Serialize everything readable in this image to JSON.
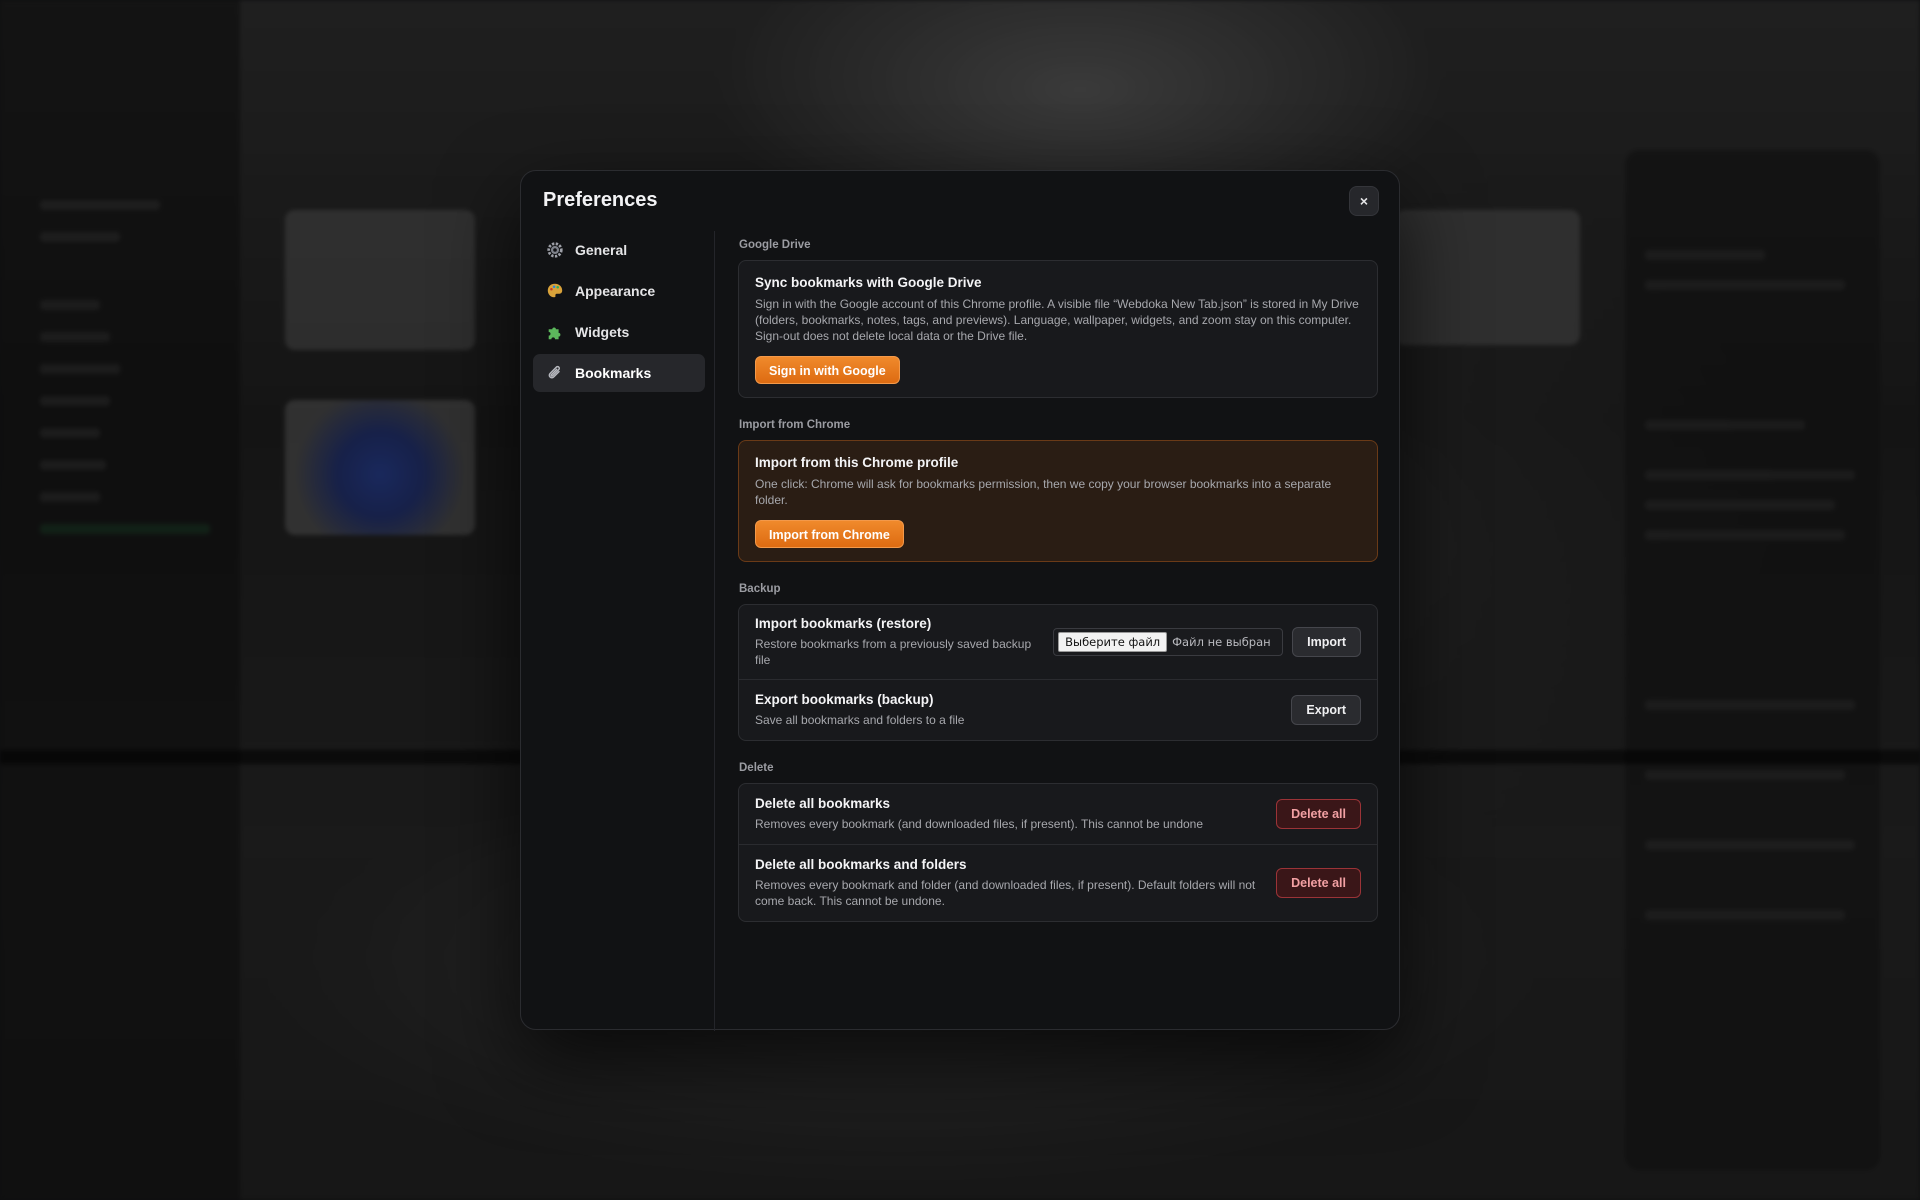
{
  "modal": {
    "title": "Preferences",
    "close_label": "×"
  },
  "nav": {
    "items": [
      {
        "label": "General",
        "icon": "gear-icon",
        "active": false
      },
      {
        "label": "Appearance",
        "icon": "palette-icon",
        "active": false
      },
      {
        "label": "Widgets",
        "icon": "puzzle-icon",
        "active": false
      },
      {
        "label": "Bookmarks",
        "icon": "paperclip-icon",
        "active": true
      }
    ]
  },
  "google_drive": {
    "section_label": "Google Drive",
    "title": "Sync bookmarks with Google Drive",
    "description": "Sign in with the Google account of this Chrome profile. A visible file “Webdoka New Tab.json” is stored in My Drive (folders, bookmarks, notes, tags, and previews). Language, wallpaper, widgets, and zoom stay on this computer. Sign-out does not delete local data or the Drive file.",
    "button": "Sign in with Google"
  },
  "import_chrome": {
    "section_label": "Import from Chrome",
    "title": "Import from this Chrome profile",
    "description": "One click: Chrome will ask for bookmarks permission, then we copy your browser bookmarks into a separate folder.",
    "button": "Import from Chrome"
  },
  "backup": {
    "section_label": "Backup",
    "import_title": "Import bookmarks (restore)",
    "import_description": "Restore bookmarks from a previously saved backup file",
    "file_choose_label": "Выберите файл",
    "file_status": "Файл не выбран",
    "import_button": "Import",
    "export_title": "Export bookmarks (backup)",
    "export_description": "Save all bookmarks and folders to a file",
    "export_button": "Export"
  },
  "delete": {
    "section_label": "Delete",
    "all_bookmarks_title": "Delete all bookmarks",
    "all_bookmarks_description": "Removes every bookmark (and downloaded files, if present). This cannot be undone",
    "all_bookmarks_button": "Delete all",
    "all_folders_title": "Delete all bookmarks and folders",
    "all_folders_description": "Removes every bookmark and folder (and downloaded files, if present). Default folders will not come back. This cannot be undone.",
    "all_folders_button": "Delete all"
  },
  "colors": {
    "accent": "#e8781e",
    "danger": "#9b3337",
    "modal_bg": "#111214"
  }
}
